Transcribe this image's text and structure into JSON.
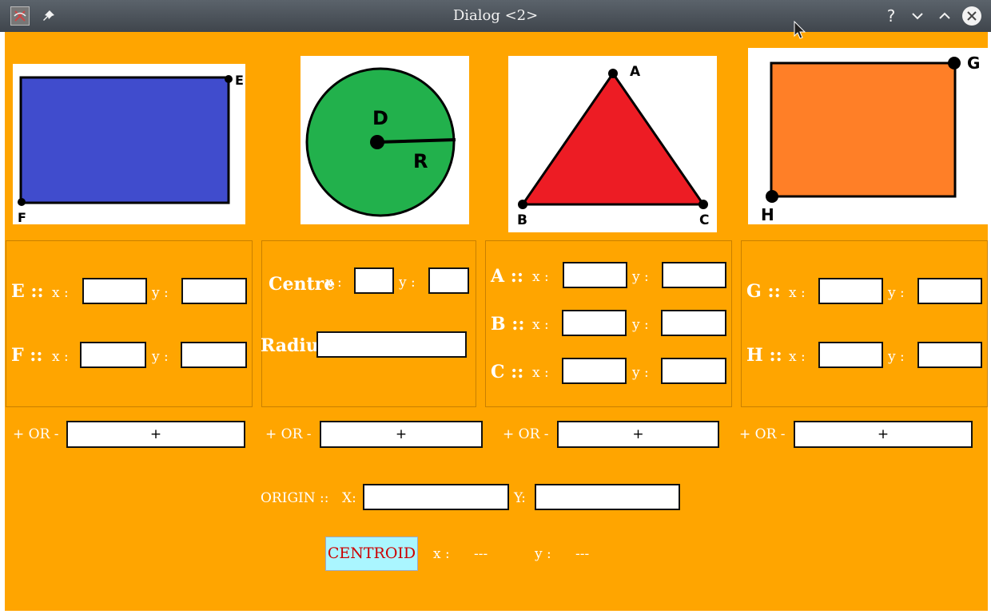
{
  "window": {
    "title": "Dialog <2>",
    "help_glyph": "?",
    "app_icon": "app-icon",
    "pin_icon": "pin-icon",
    "minimize_icon": "chevron-down-icon",
    "maximize_icon": "chevron-up-icon",
    "close_icon": "close-icon"
  },
  "colors": {
    "background": "#ffa500",
    "rectangle_fill": "#404ccd",
    "circle_fill": "#22b14c",
    "triangle_fill": "#ed1c24",
    "square_fill": "#ff7f27",
    "centroid_button_bg": "#aaf6ff",
    "centroid_button_text": "#cc0000"
  },
  "shapes": {
    "rectangle": {
      "point_top": "E",
      "point_bottom": "F"
    },
    "circle": {
      "center": "D",
      "radius": "R"
    },
    "triangle": {
      "top": "A",
      "bottom_left": "B",
      "bottom_right": "C"
    },
    "square": {
      "point_top": "G",
      "point_bottom": "H"
    }
  },
  "panel1": {
    "row1_label": "E ::",
    "row2_label": "F ::",
    "x_label": "x :",
    "y_label": "y :",
    "e_x": "",
    "e_y": "",
    "f_x": "",
    "f_y": ""
  },
  "panel2": {
    "centre_label": "Centre",
    "radius_label": "Radius",
    "x_label": "x :",
    "y_label": "y :",
    "centre_x": "",
    "centre_y": "",
    "radius": ""
  },
  "panel3": {
    "row1_label": "A ::",
    "row2_label": "B ::",
    "row3_label": "C ::",
    "x_label": "x :",
    "y_label": "y :",
    "a_x": "",
    "a_y": "",
    "b_x": "",
    "b_y": "",
    "c_x": "",
    "c_y": ""
  },
  "panel4": {
    "row1_label": "G ::",
    "row2_label": "H ::",
    "x_label": "x :",
    "y_label": "y :",
    "g_x": "",
    "g_y": "",
    "h_x": "",
    "h_y": ""
  },
  "operations": {
    "label": "+ OR -",
    "button_label": "+"
  },
  "origin": {
    "label": "ORIGIN ::",
    "x_label": "X:",
    "y_label": "Y:",
    "x_value": "",
    "y_value": ""
  },
  "centroid": {
    "button_label": "CENTROID",
    "x_label": "x :",
    "y_label": "y :",
    "x_value": "---",
    "y_value": "---"
  }
}
